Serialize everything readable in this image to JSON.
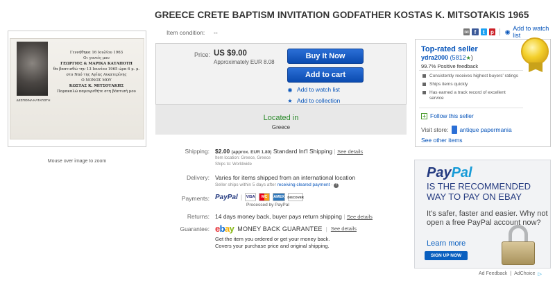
{
  "listing": {
    "title": "GREECE CRETE BAPTISM INVITATION GODFATHER KOSTAS K. MITSOTAKIS 1965",
    "image_hint": "Mouse over image to zoom",
    "card_lines": [
      "Γεννήθηκα 16 Ιουλίου 1963",
      "Οι γονείς μου",
      "ΓΕΩΡΓΙΟΣ & ΜΑΡΙΚΑ ΚΑΤΑΠΟΤΗ",
      "θα βαπτισθώ την 13 Ιουνίου 1965 ώρα 6 μ. μ.",
      "στο Ναό της Αγίας Αικατερίνης",
      "Ο ΝΟΝΟΣ ΜΟΥ",
      "ΚΩΣΤΑΣ Κ. ΜΙΤΣΟΤΑΚΗΣ",
      "Παρακαλώ παρευρεθήτε στη βάπτισή μου"
    ],
    "card_name": "ΔΕΣΠΟΙΝΑ ΚΑΤΑΠΟΤΗ"
  },
  "condition": {
    "label": "Item condition:",
    "value": "--"
  },
  "share": {
    "add_to_watch": "Add to watch list"
  },
  "buy": {
    "price_label": "Price:",
    "price": "US $9.00",
    "approx": "Approximately EUR 8.08",
    "buy_now": "Buy It Now",
    "add_to_cart": "Add to cart",
    "watch": "Add to watch list",
    "collection": "Add to collection",
    "located_label": "Located in",
    "located_value": "Greece"
  },
  "shipping": {
    "label": "Shipping:",
    "cost": "$2.00",
    "approx": "(approx. EUR 1.80)",
    "service": "Standard Int'l Shipping",
    "see_details": "See details",
    "item_location": "Item location:  Greece, Greece",
    "ships_to": "Ships to:  Worldwide"
  },
  "delivery": {
    "label": "Delivery:",
    "text": "Varies for items shipped from an international location",
    "note_prefix": "Seller ships within 5 days after",
    "note_link": "receiving cleared payment",
    "note_suffix": "-"
  },
  "payments": {
    "label": "Payments:",
    "paypal": "PayPal",
    "cards": [
      "VISA",
      "MC",
      "AMEX",
      "DISCOVER"
    ],
    "processed": "Processed by PayPal"
  },
  "returns": {
    "label": "Returns:",
    "text": "14 days money back, buyer pays return shipping",
    "see_details": "See details"
  },
  "guarantee": {
    "label": "Guarantee:",
    "logo": "ebay",
    "title": "MONEY BACK GUARANTEE",
    "see_details": "See details",
    "line1": "Get the item you ordered or get your money back.",
    "line2": "Covers your purchase price and original shipping."
  },
  "seller": {
    "badge": "Top-rated seller",
    "name": "ydra2000",
    "score": "(5812",
    "score_end": ")",
    "positive": "99.7% Positive feedback",
    "bullets": [
      "Consistently receives highest buyers' ratings",
      "Ships items quickly",
      "Has earned a track record of excellent service"
    ],
    "follow": "Follow this seller",
    "visit_label": "Visit store:",
    "store": "antique papermania",
    "see_other": "See other items"
  },
  "ad": {
    "logo_a": "Pay",
    "logo_b": "Pal",
    "headline": "IS THE RECOMMENDED WAY TO PAY ON EBAY",
    "sub": "It's safer, faster and easier. Why not open a free PayPal account now?",
    "learn": "Learn more",
    "button": "SIGN UP NOW",
    "feedback": "Ad Feedback",
    "adchoice": "AdChoice"
  },
  "colors": {
    "link": "#0654ba",
    "buy_button": "#0b4bb0",
    "located_green": "#2a8a2a",
    "paypal_navy": "#253b80",
    "paypal_light": "#179bd7"
  }
}
